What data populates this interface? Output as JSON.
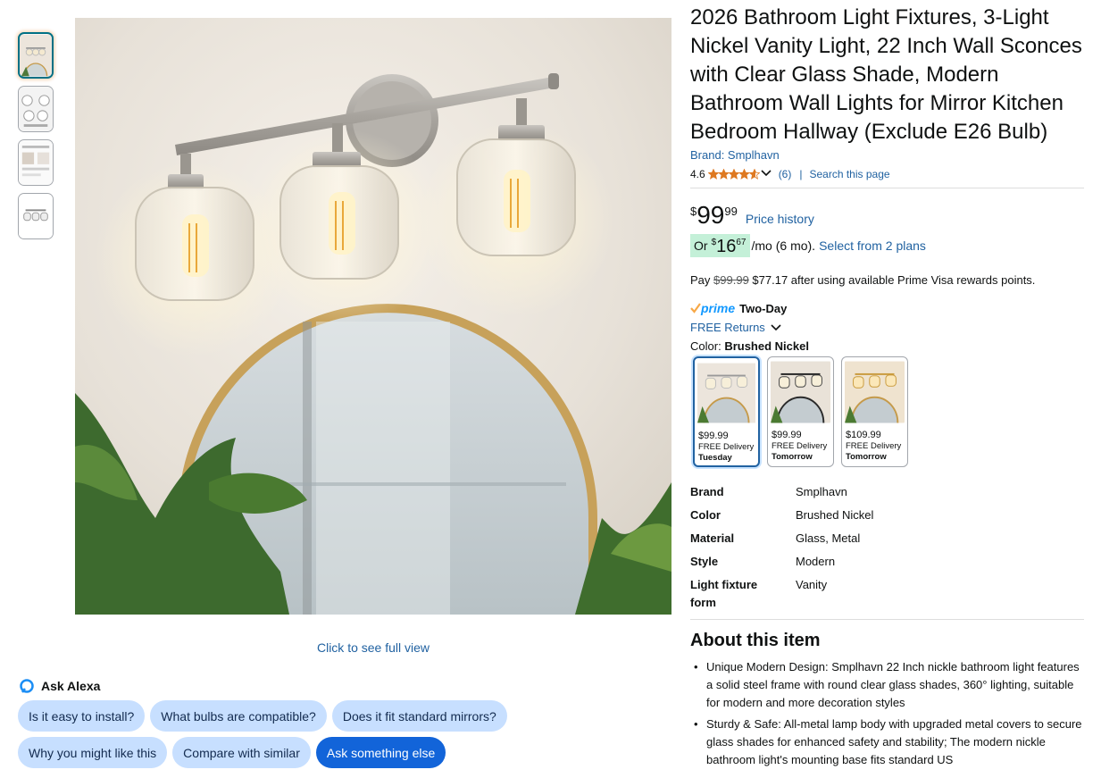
{
  "gallery": {
    "full_view_label": "Click to see full view"
  },
  "alexa": {
    "title": "Ask Alexa",
    "row1": [
      "Is it easy to install?",
      "What bulbs are compatible?",
      "Does it fit standard mirrors?"
    ],
    "row2": [
      "Why you might like this",
      "Compare with similar",
      "Ask something else"
    ]
  },
  "product": {
    "title": "2026 Bathroom Light Fixtures, 3-Light Nickel Vanity Light, 22 Inch Wall Sconces with Clear Glass Shade, Modern Bathroom Wall Lights for Mirror Kitchen Bedroom Hallway (Exclude E26 Bulb)",
    "brand_link": "Brand: Smplhavn",
    "rating": "4.6",
    "rating_stars": 4.6,
    "review_count": "(6)",
    "separator": "|",
    "search_page": "Search this page"
  },
  "price": {
    "symbol": "$",
    "whole": "99",
    "fraction": "99",
    "history_link": "Price history"
  },
  "plan": {
    "or": "Or",
    "symbol": "$",
    "whole": "16",
    "fraction": "67",
    "per": "/mo (6 mo).",
    "select_link": "Select from 2 plans"
  },
  "rewards": {
    "prefix": "Pay",
    "old_price": "$99.99",
    "suffix": "$77.17 after using available Prime Visa rewards points."
  },
  "delivery": {
    "prime": "prime",
    "speed": "Two-Day",
    "returns": "FREE Returns"
  },
  "color": {
    "label": "Color:",
    "selected": "Brushed Nickel",
    "swatches": [
      {
        "price": "$99.99",
        "delivery": "FREE Delivery",
        "day": "Tuesday"
      },
      {
        "price": "$99.99",
        "delivery": "FREE Delivery",
        "day": "Tomorrow"
      },
      {
        "price": "$109.99",
        "delivery": "FREE Delivery",
        "day": "Tomorrow"
      }
    ]
  },
  "specs": [
    {
      "key": "Brand",
      "value": "Smplhavn"
    },
    {
      "key": "Color",
      "value": "Brushed Nickel"
    },
    {
      "key": "Material",
      "value": "Glass, Metal"
    },
    {
      "key": "Style",
      "value": "Modern"
    },
    {
      "key": "Light fixture form",
      "value": "Vanity"
    }
  ],
  "about": {
    "heading": "About this item",
    "bullets": [
      "Unique Modern Design: Smplhavn 22 Inch nickle bathroom light features a solid steel frame with round clear glass shades, 360° lighting, suitable for modern and more decoration styles",
      "Sturdy & Safe: All-metal lamp body with upgraded metal covers to secure glass shades for enhanced safety and stability; The modern nickle bathroom light's mounting base fits standard US"
    ]
  },
  "colors": {
    "link": "#2162a1",
    "chip": "#c7dfff",
    "chip_primary": "#1264d9",
    "star": "#de7921",
    "plan_badge": "#c4f0d8",
    "prime_blue": "#1399ff"
  }
}
